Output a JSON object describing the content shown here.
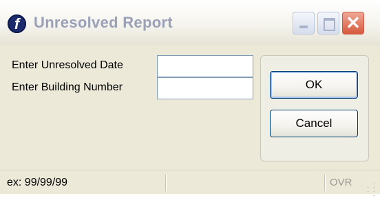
{
  "window": {
    "title": "Unresolved Report",
    "app_icon_letter": "f",
    "app_icon": "app-icon",
    "controls": {
      "minimize_icon": "minimize-icon",
      "maximize_icon": "maximize-icon",
      "close_icon": "close-icon",
      "close_glyph": "✕"
    }
  },
  "form": {
    "date_label": "Enter Unresolved Date",
    "date_value": "",
    "building_label": "Enter Building Number",
    "building_value": ""
  },
  "buttons": {
    "ok_label": "OK",
    "cancel_label": "Cancel"
  },
  "statusbar": {
    "hint": "ex: 99/99/99",
    "mode": "OVR"
  },
  "colors": {
    "title_text": "#9aa0b6",
    "close_button": "#d7583e",
    "window_bg": "#ece9d8"
  }
}
